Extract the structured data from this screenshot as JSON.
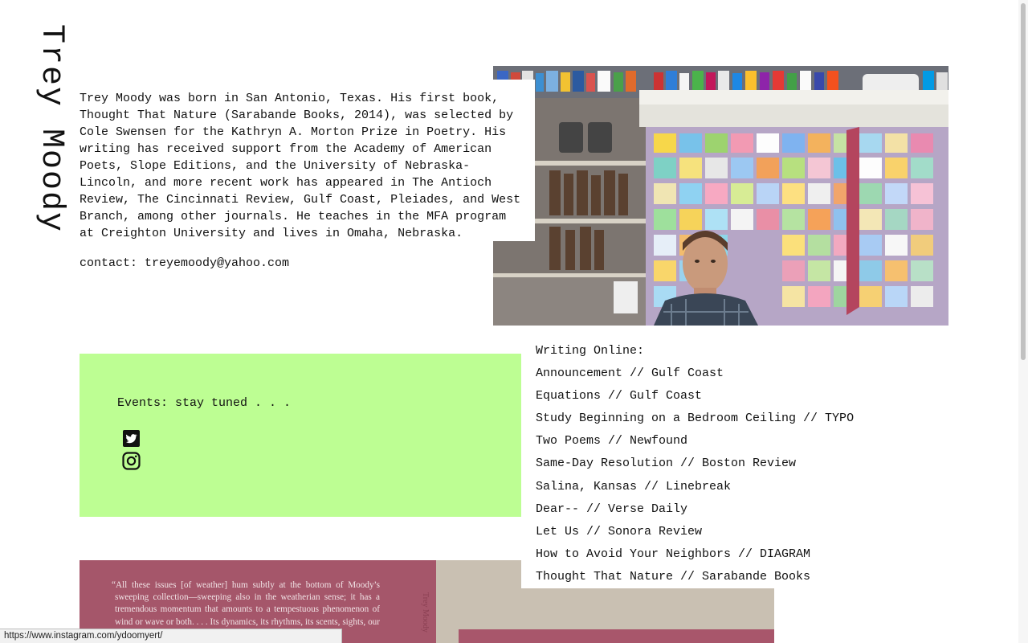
{
  "site": {
    "title": "Trey Moody"
  },
  "bio": {
    "text": "Trey Moody was born in San Antonio, Texas. His first book, Thought That Nature (Sarabande Books, 2014), was selected by Cole Swensen for the Kathryn A. Morton Prize in Poetry. His writing has received support from the Academy of American Poets, Slope Editions, and the University of Nebraska-Lincoln, and more recent work has appeared in The Antioch Review, The Cincinnati Review, Gulf Coast, Pleiades, and West Branch, among other journals. He teaches in the MFA program at Creighton University and lives in Omaha, Nebraska.",
    "contact": "contact: treyemoody@yahoo.com"
  },
  "events": {
    "text": "Events: stay tuned . . .",
    "icons": [
      "twitter-icon",
      "instagram-icon"
    ]
  },
  "writing": {
    "heading": "Writing Online:",
    "links": [
      "Announcement // Gulf Coast",
      "Equations // Gulf Coast",
      "Study Beginning on a Bedroom Ceiling // TYPO",
      "Two Poems // Newfound",
      "Same-Day Resolution // Boston Review",
      "Salina, Kansas // Linebreak",
      "Dear-- // Verse Daily",
      "Let Us // Sonora Review",
      "How to Avoid Your Neighbors // DIAGRAM",
      "Thought That Nature // Sarabande Books"
    ]
  },
  "book": {
    "quote": "“All these issues [of weather] hum subtly at the bottom of Moody’s sweeping collection—sweeping also in the weatherian sense; it has a tremendous momentum that amounts to a tempestuous phenomenon of wind or wave or both. . . . Its dynamics, its rhythms, its scents, sights, our senses,",
    "spine_title": "Trey Moody"
  },
  "status_bar": {
    "url": "https://www.instagram.com/ydoomyert/"
  },
  "colors": {
    "events_bg": "#bdfe93",
    "book_cover": "#a5566a",
    "text": "#111111"
  }
}
